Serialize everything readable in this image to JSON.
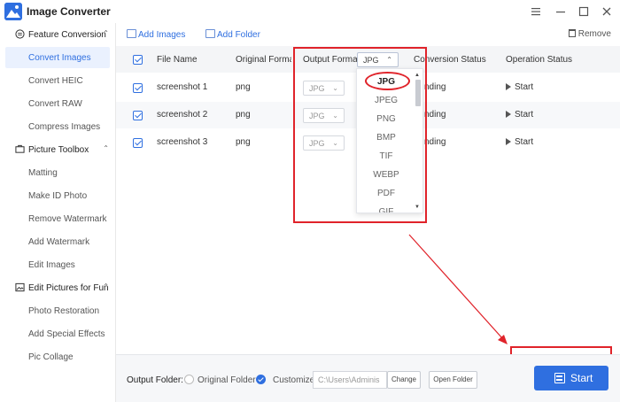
{
  "app": {
    "title": "Image Converter",
    "logo_icon": "mountain-photo-icon",
    "window_controls": [
      "menu-icon",
      "minimize-icon",
      "maximize-icon",
      "close-icon"
    ]
  },
  "sidebar": {
    "sections": [
      {
        "label": "Feature Conversion",
        "icon": "convert-icon",
        "items": [
          "Convert Images",
          "Convert HEIC",
          "Convert RAW",
          "Compress Images"
        ]
      },
      {
        "label": "Picture Toolbox",
        "icon": "toolbox-icon",
        "items": [
          "Matting",
          "Make ID Photo",
          "Remove Watermark",
          "Add Watermark",
          "Edit Images"
        ]
      },
      {
        "label": "Edit Pictures for Fun",
        "icon": "picture-icon",
        "items": [
          "Photo Restoration",
          "Add Special Effects",
          "Pic Collage"
        ]
      }
    ],
    "active_item": "Convert Images"
  },
  "toolbar": {
    "add_images": "Add Images",
    "add_folder": "Add Folder",
    "remove": "Remove"
  },
  "table": {
    "headers": {
      "file_name": "File Name",
      "original_format": "Original Format",
      "output_format": "Output Format",
      "conversion_status": "Conversion Status",
      "operation_status": "Operation Status"
    },
    "header_format_value": "JPG",
    "rows": [
      {
        "file_name": "screenshot 1",
        "original_format": "png",
        "output_format": "JPG",
        "status": "nding",
        "operation": "Start"
      },
      {
        "file_name": "screenshot 2",
        "original_format": "png",
        "output_format": "JPG",
        "status": "nding",
        "operation": "Start"
      },
      {
        "file_name": "screenshot 3",
        "original_format": "png",
        "output_format": "JPG",
        "status": "nding",
        "operation": "Start"
      }
    ]
  },
  "dropdown": {
    "options": [
      "JPG",
      "JPEG",
      "PNG",
      "BMP",
      "TIF",
      "WEBP",
      "PDF",
      "GIF"
    ],
    "selected": "JPG"
  },
  "bottom": {
    "output_folder_label": "Output Folder:",
    "original_folder": "Original Folder",
    "customize": "Customize",
    "path": "C:\\Users\\Adminis",
    "change": "Change",
    "open_folder": "Open Folder",
    "start": "Start"
  },
  "colors": {
    "accent": "#2f6fe0",
    "annotation": "#e0232a"
  }
}
